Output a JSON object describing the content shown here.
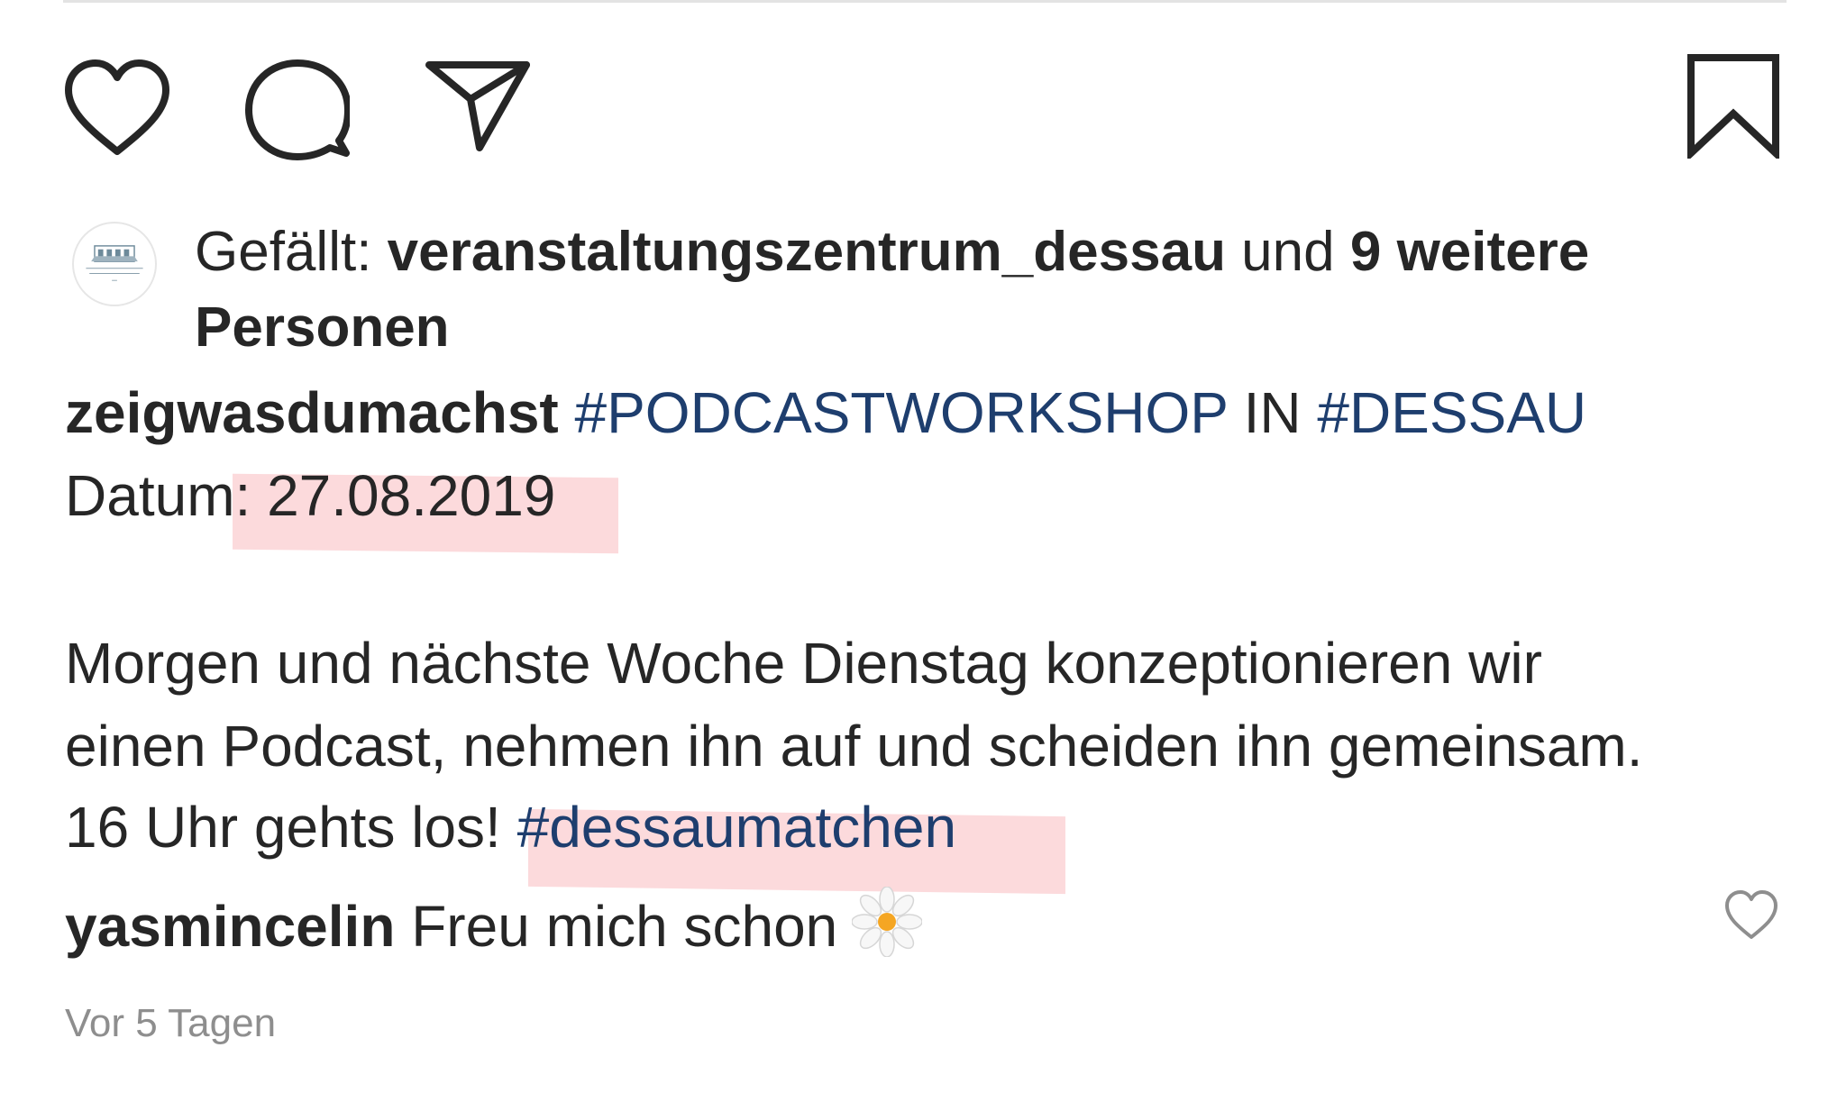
{
  "actions": {
    "like_icon": "heart-outline",
    "comment_icon": "speech-bubble-outline",
    "share_icon": "paper-plane-outline",
    "save_icon": "bookmark-outline"
  },
  "likes": {
    "prefix": "Gefällt: ",
    "first_liker": "veranstaltungszentrum_dessau",
    "connector": " und ",
    "others": "9 weitere Personen"
  },
  "caption": {
    "username": "zeigwasdumachst",
    "hashtag_1": "#PODCASTWORKSHOP",
    "middle_word": " IN ",
    "hashtag_2": "#DESSAU",
    "date_label": "Datum: 27.08.2019",
    "body_line_1": "Morgen und nächste Woche Dienstag konzeptionieren wir",
    "body_line_2": "einen Podcast, nehmen ihn auf und scheiden ihn gemeinsam.",
    "body_line_3_text": "16 Uhr gehts los! ",
    "body_line_3_hashtag": "#dessaumatchen"
  },
  "comment": {
    "username": "yasmincelin",
    "text": " Freu mich schon",
    "emoji_icon": "daisy-flower"
  },
  "timestamp": "Vor 5 Tagen",
  "colors": {
    "text": "#262626",
    "hashtag": "#1e3e6e",
    "muted": "#8e8e8e",
    "highlight": "#fbd4d6"
  }
}
